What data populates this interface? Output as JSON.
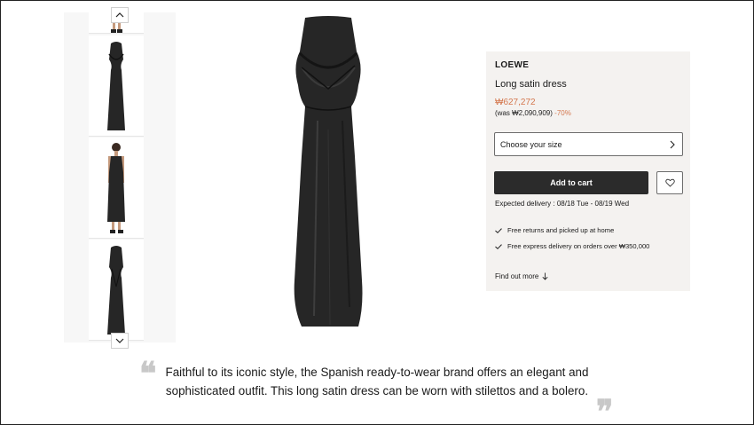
{
  "gallery": {
    "thumbnails": [
      {
        "alt": "dress-detail-feet"
      },
      {
        "alt": "dress-front"
      },
      {
        "alt": "dress-worn"
      },
      {
        "alt": "dress-back"
      }
    ],
    "up_icon": "chevron-up-icon",
    "down_icon": "chevron-down-icon"
  },
  "product": {
    "brand": "LOEWE",
    "name": "Long satin dress",
    "price": "₩627,272",
    "was_label": "(was ₩2,090,909)",
    "discount": "-70%",
    "size_placeholder": "Choose your size",
    "add_to_cart": "Add to cart",
    "wishlist_icon": "heart-icon",
    "delivery": "Expected delivery : 08/18 Tue - 08/19 Wed",
    "perks": [
      "Free returns and picked up at home",
      "Free express delivery on orders over ₩350,000"
    ],
    "find_out_more": "Find out more"
  },
  "description": "Faithful to its iconic style, the Spanish ready-to-wear brand offers an elegant and sophisticated outfit. This long satin dress can be worn with stilettos and a bolero.",
  "quotes": {
    "open": "❝",
    "close": "❞"
  },
  "colors": {
    "accent": "#d4784f",
    "panel_bg": "#f4f2f0",
    "button_bg": "#2b2b2b",
    "dress": "#262626"
  }
}
